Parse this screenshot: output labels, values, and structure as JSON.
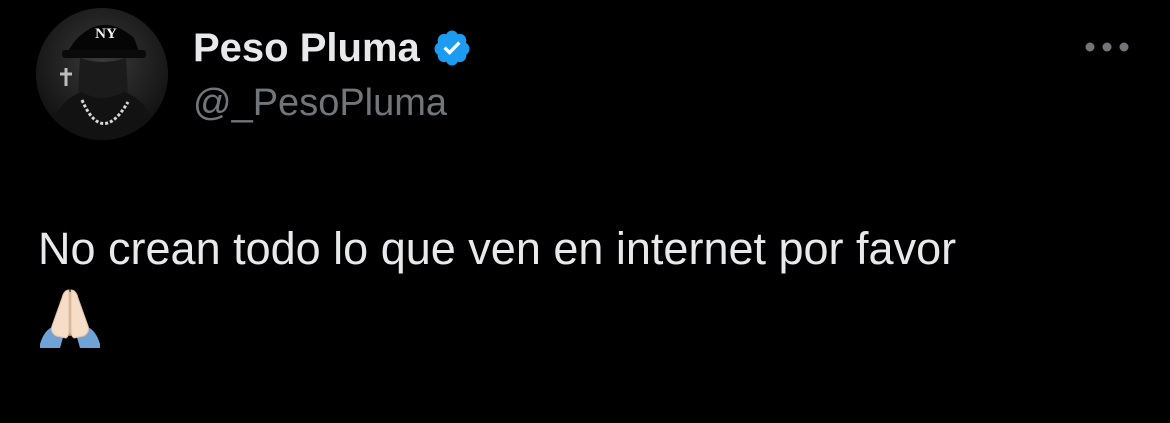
{
  "author": {
    "name": "Peso Pluma",
    "handle": "@_PesoPluma",
    "verified_icon": "verified-badge-icon",
    "avatar_cap_logo": "NY"
  },
  "menu": {
    "icon": "more-horizontal-icon"
  },
  "tweet": {
    "text": "No crean todo lo que ven en internet por favor",
    "emoji": "folded-hands-emoji"
  },
  "colors": {
    "background": "#000000",
    "primary_text": "#e7e9ea",
    "secondary_text": "#71767b",
    "verified_blue": "#1d9bf0"
  }
}
